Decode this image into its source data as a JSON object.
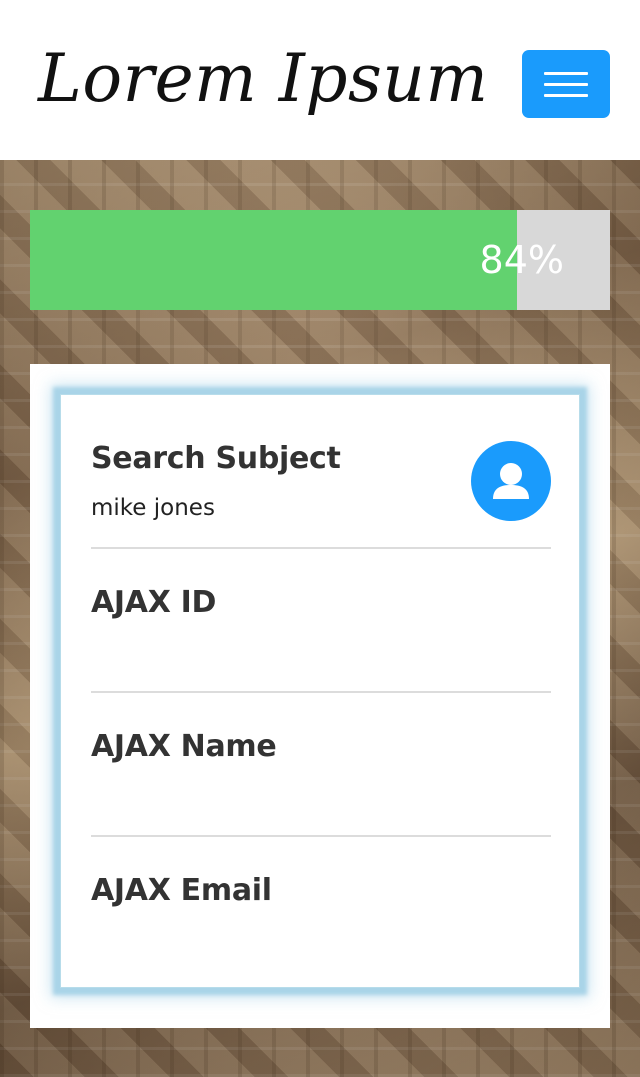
{
  "header": {
    "logo_text": "Lorem Ipsum",
    "menu_icon": "hamburger-menu-icon"
  },
  "progress": {
    "percent": 84,
    "label": "84%"
  },
  "card": {
    "subject": {
      "label": "Search Subject",
      "value": "mike jones",
      "avatar_icon": "user-avatar-icon"
    },
    "ajax_id": {
      "label": "AJAX ID"
    },
    "ajax_name": {
      "label": "AJAX Name"
    },
    "ajax_email": {
      "label": "AJAX Email"
    }
  },
  "colors": {
    "accent": "#1a9bfc",
    "progress_fill": "#62d26f",
    "progress_track": "#d8d8d8",
    "card_glow": "#a9d4e8"
  }
}
